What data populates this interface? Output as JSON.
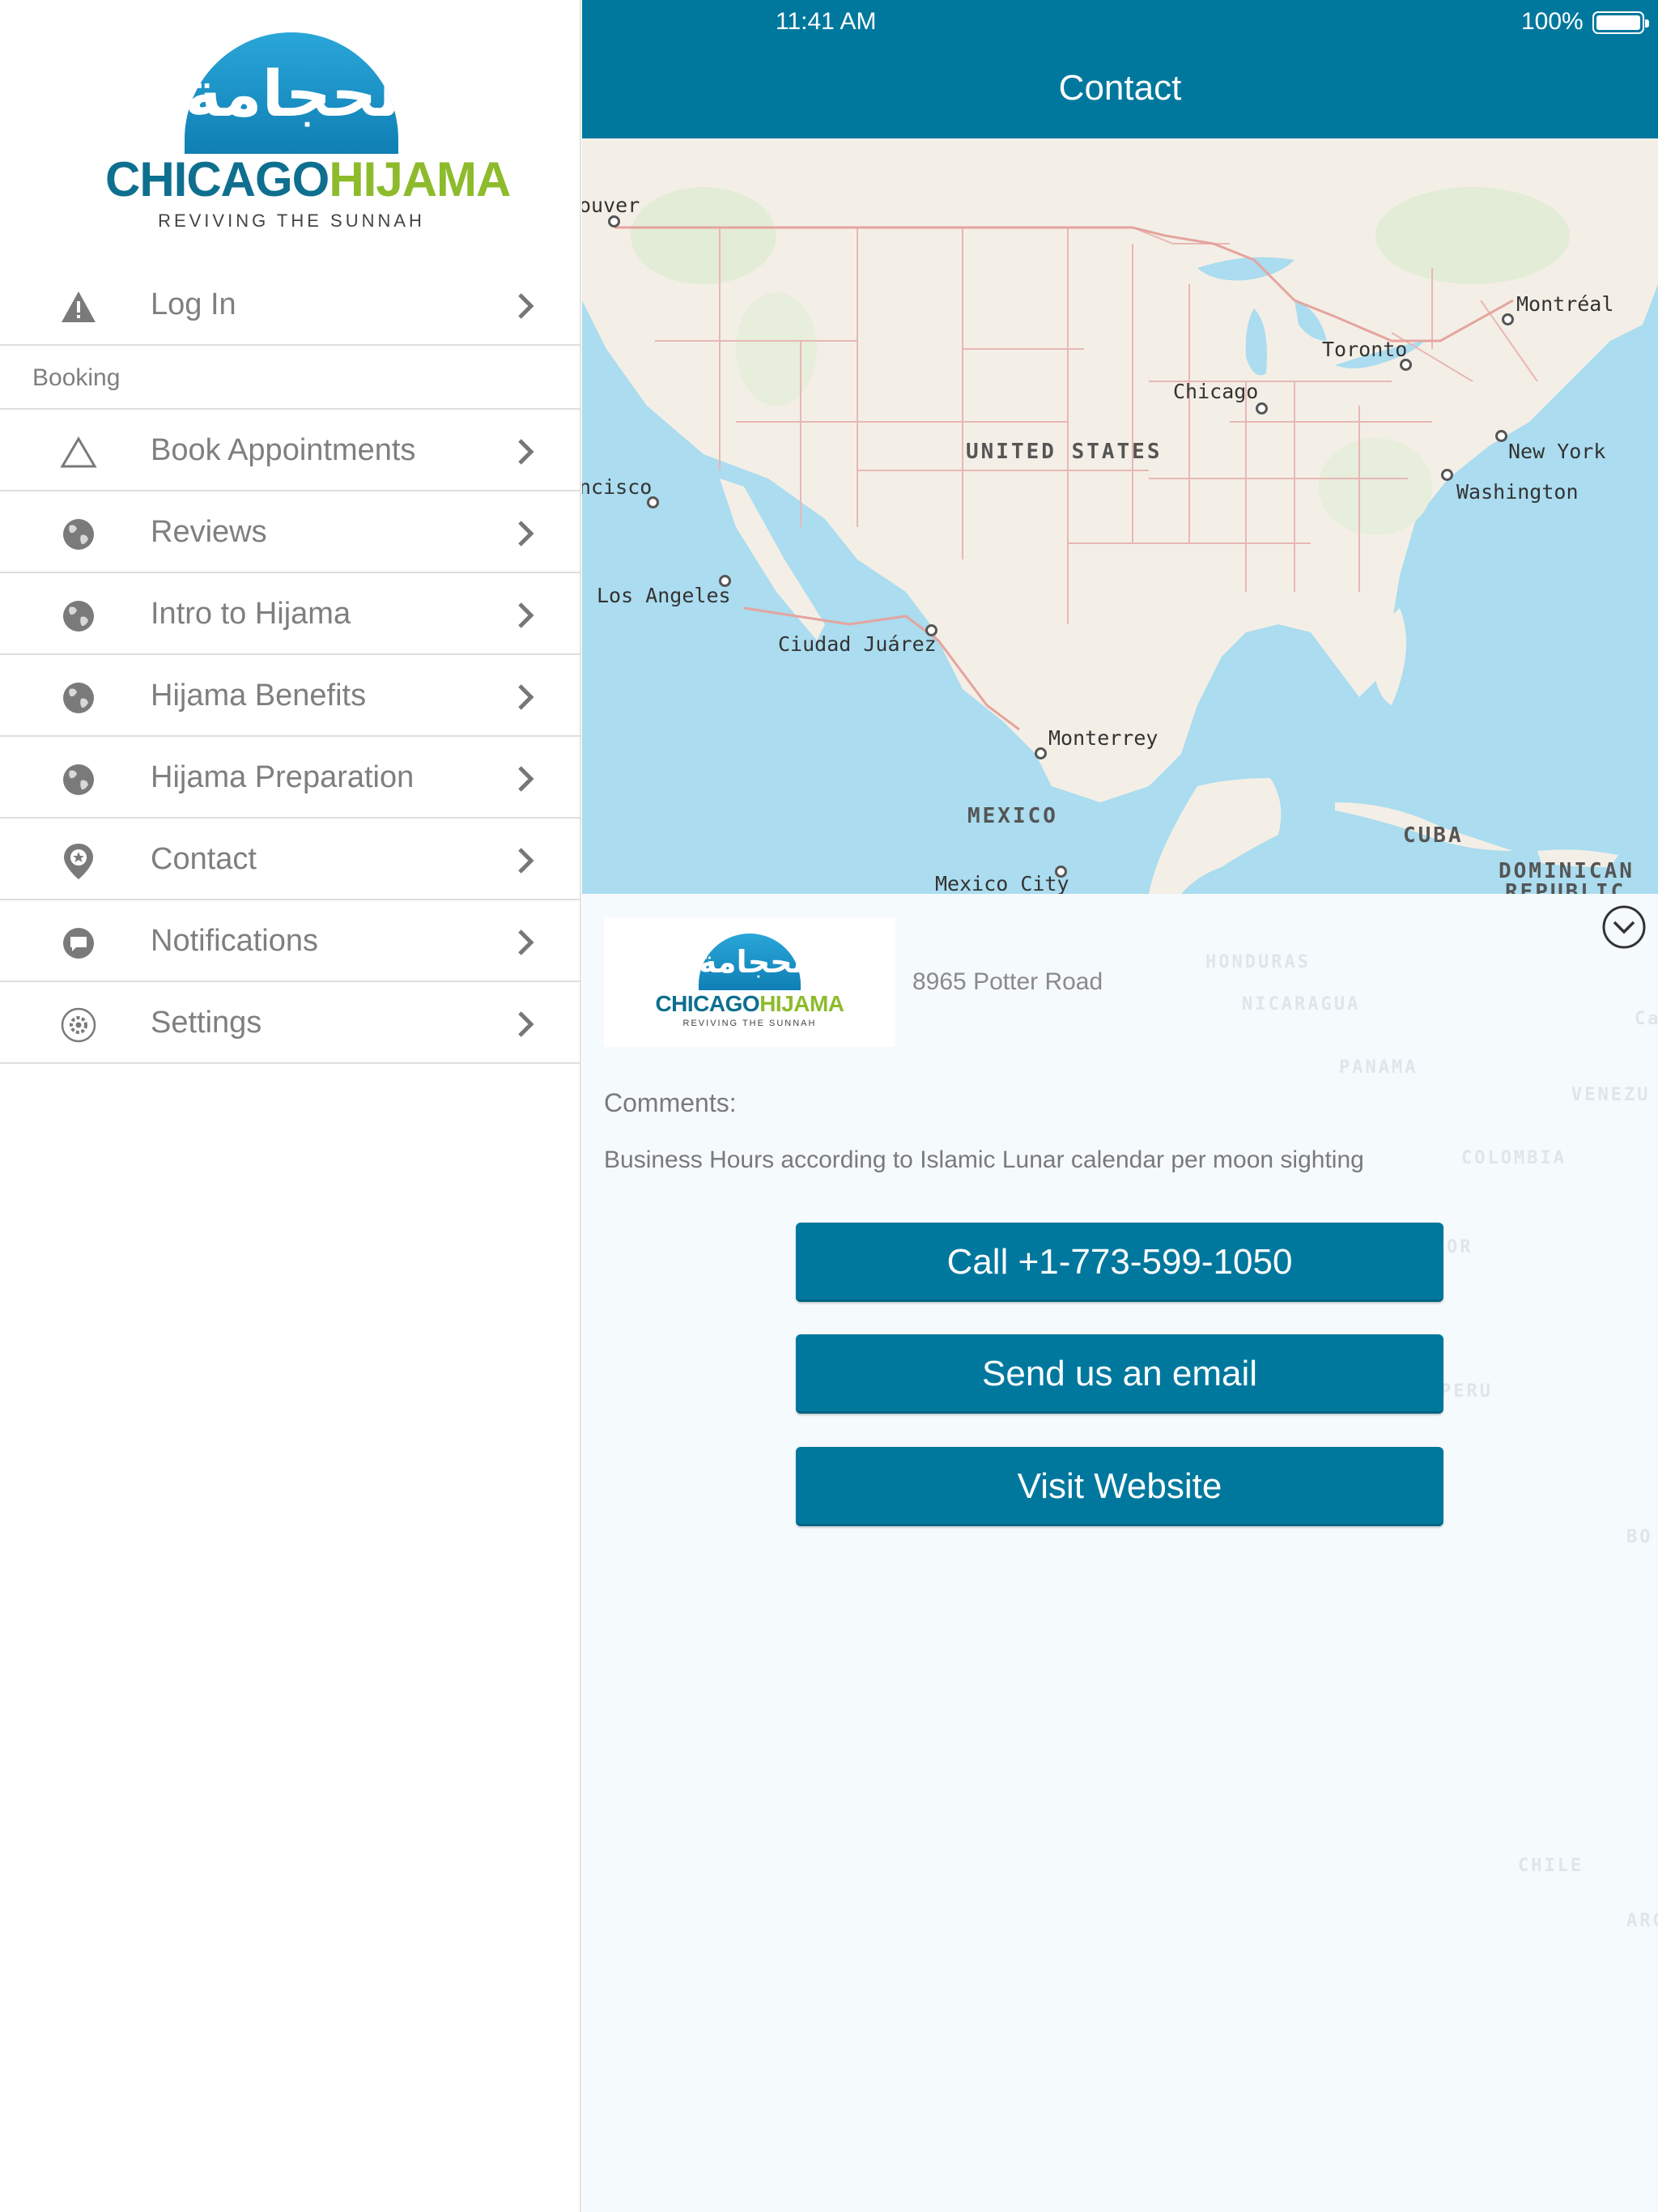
{
  "status_bar": {
    "time": "11:41 AM",
    "battery": "100%"
  },
  "logo": {
    "arabic": "الحجامة",
    "brand_part1": "CHICAGO",
    "brand_part2": "HIJAMA",
    "tagline": "REVIVING THE SUNNAH"
  },
  "sidebar": {
    "login": {
      "label": "Log In",
      "icon": "warning-icon"
    },
    "section_header": "Booking",
    "items": [
      {
        "label": "Book Appointments",
        "icon": "triangle-icon"
      },
      {
        "label": "Reviews",
        "icon": "globe-icon"
      },
      {
        "label": "Intro to Hijama",
        "icon": "globe-icon"
      },
      {
        "label": "Hijama Benefits",
        "icon": "globe-icon"
      },
      {
        "label": "Hijama Preparation",
        "icon": "globe-icon"
      },
      {
        "label": "Contact",
        "icon": "map-pin-icon"
      },
      {
        "label": "Notifications",
        "icon": "chat-bubble-icon"
      },
      {
        "label": "Settings",
        "icon": "gear-icon"
      }
    ]
  },
  "header": {
    "title": "Contact"
  },
  "map": {
    "cities": [
      "ouver",
      "Montréal",
      "Toronto",
      "Chicago",
      "New York",
      "Washington",
      "ncisco",
      "Los Angeles",
      "Ciudad Juárez",
      "Monterrey",
      "Mexico City"
    ],
    "countries": [
      "UNITED STATES",
      "MEXICO",
      "CUBA",
      "DOMINICAN",
      "REPUBLIC"
    ],
    "faded_labels": [
      "HONDURAS",
      "NICARAGUA",
      "PANAMA",
      "VENEZU",
      "COLOMBIA",
      "OR",
      "PERU",
      "BO",
      "CHILE",
      "ARG",
      "Ca"
    ]
  },
  "contact": {
    "address": "8965 Potter Road",
    "comments_label": "Comments:",
    "comments_text": "Business Hours according to Islamic Lunar calendar per moon sighting",
    "call_label": "Call +1-773-599-1050",
    "email_label": "Send us an email",
    "website_label": "Visit Website"
  },
  "colors": {
    "accent": "#00789e",
    "brand_blue": "#0e6f8f",
    "brand_green": "#8dbb2b",
    "map_water": "#abdcef",
    "map_land": "#f4efe6"
  }
}
